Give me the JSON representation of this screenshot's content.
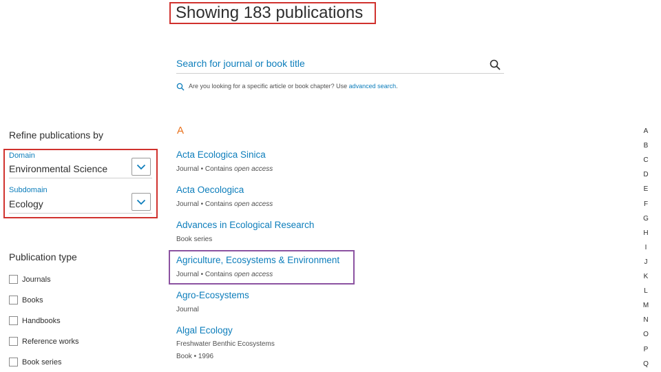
{
  "header": {
    "title": "Showing 183 publications"
  },
  "search": {
    "placeholder": "Search for journal or book title",
    "hint_text": "Are you looking for a specific article or book chapter? Use ",
    "hint_link": "advanced search",
    "hint_end": ".",
    "icon": "search-icon"
  },
  "sidebar": {
    "refine_heading": "Refine publications by",
    "domain": {
      "label": "Domain",
      "value": "Environmental Science"
    },
    "subdomain": {
      "label": "Subdomain",
      "value": "Ecology"
    },
    "pubtype_heading": "Publication type",
    "pubtypes": [
      "Journals",
      "Books",
      "Handbooks",
      "Reference works",
      "Book series"
    ]
  },
  "list": {
    "section_letter": "A",
    "items": [
      {
        "title": "Acta Ecologica Sinica",
        "meta": "Journal",
        "sep": " • ",
        "meta2": "Contains ",
        "meta_italic": "open access"
      },
      {
        "title": "Acta Oecologica",
        "meta": "Journal",
        "sep": " • ",
        "meta2": "Contains ",
        "meta_italic": "open access"
      },
      {
        "title": "Advances in Ecological Research",
        "meta": "Book series"
      },
      {
        "title": "Agriculture, Ecosystems & Environment",
        "meta": "Journal",
        "sep": " • ",
        "meta2": "Contains ",
        "meta_italic": "open access"
      },
      {
        "title": "Agro-Ecosystems",
        "meta": "Journal"
      },
      {
        "title": "Algal Ecology",
        "subtitle": "Freshwater Benthic Ecosystems",
        "meta": "Book",
        "sep": " • ",
        "meta2": "1996"
      }
    ]
  },
  "alphabet": [
    "A",
    "B",
    "C",
    "D",
    "E",
    "F",
    "G",
    "H",
    "I",
    "J",
    "K",
    "L",
    "M",
    "N",
    "O",
    "P",
    "Q"
  ],
  "colors": {
    "link_blue": "#0c7dbb",
    "accent_orange": "#e9711c",
    "highlight_red": "#d0312d",
    "highlight_purple": "#8b52a1"
  }
}
